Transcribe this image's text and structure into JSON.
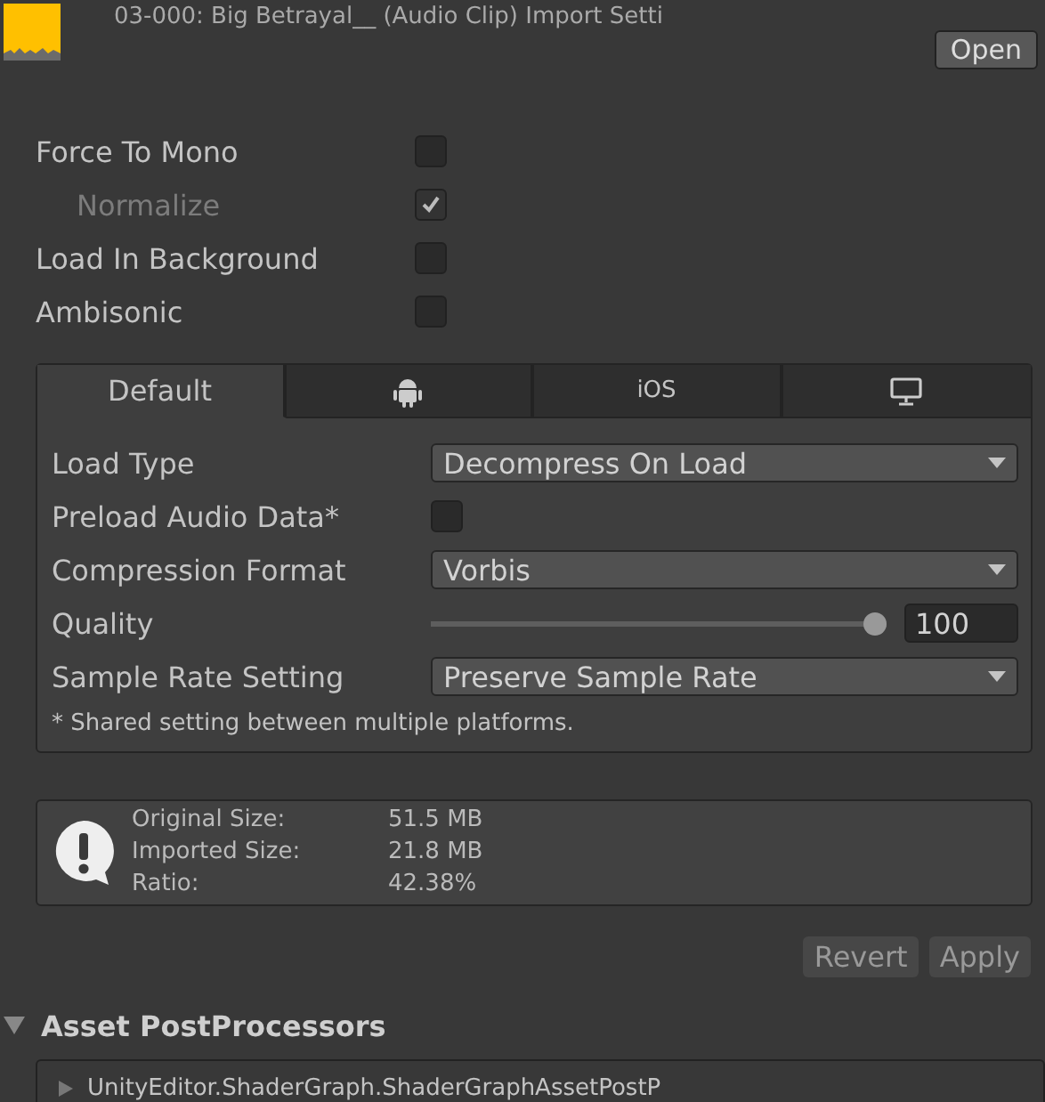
{
  "header": {
    "title": "03-000: Big Betrayal__ (Audio Clip) Import Setti",
    "open_button": "Open"
  },
  "options": [
    {
      "label": "Force To Mono",
      "checked": false,
      "indented": false,
      "disabled": false
    },
    {
      "label": "Normalize",
      "checked": true,
      "indented": true,
      "disabled": true
    },
    {
      "label": "Load In Background",
      "checked": false,
      "indented": false,
      "disabled": false
    },
    {
      "label": "Ambisonic",
      "checked": false,
      "indented": false,
      "disabled": false
    }
  ],
  "platform_tabs": [
    {
      "kind": "text",
      "label": "Default",
      "selected": true
    },
    {
      "kind": "android",
      "selected": false
    },
    {
      "kind": "text",
      "label": "iOS",
      "selected": false
    },
    {
      "kind": "desktop",
      "selected": false
    }
  ],
  "settings": [
    {
      "kind": "dropdown",
      "label": "Load Type",
      "value": "Decompress On Load"
    },
    {
      "kind": "checkbox",
      "label": "Preload Audio Data*",
      "checked": false
    },
    {
      "kind": "dropdown",
      "label": "Compression Format",
      "value": "Vorbis"
    },
    {
      "kind": "slider",
      "label": "Quality",
      "level": 1,
      "value": "100"
    },
    {
      "kind": "dropdown",
      "label": "Sample Rate Setting",
      "value": "Preserve Sample Rate"
    }
  ],
  "footnote": "* Shared setting between multiple platforms.",
  "info": [
    {
      "label": "Original Size:",
      "value": "51.5 MB"
    },
    {
      "label": "Imported Size:",
      "value": "21.8 MB"
    },
    {
      "label": "Ratio:",
      "value": "42.38%"
    }
  ],
  "buttons": [
    {
      "label": "Revert",
      "disabled": true
    },
    {
      "label": "Apply",
      "disabled": true
    }
  ],
  "section": {
    "title": "Asset PostProcessors",
    "expanded": true,
    "items": [
      {
        "label": "UnityEditor.ShaderGraph.ShaderGraphAssetPostP",
        "expanded": false
      }
    ]
  }
}
